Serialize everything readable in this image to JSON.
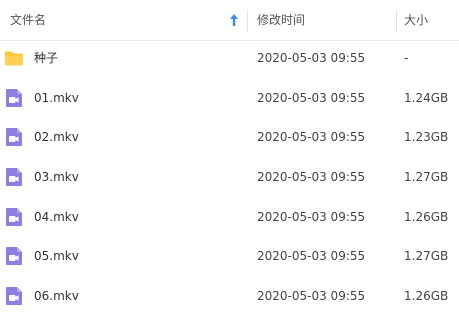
{
  "header": {
    "name_label": "文件名",
    "modified_label": "修改时间",
    "size_label": "大小",
    "sort_icon": "sort-ascending-arrow-icon"
  },
  "colors": {
    "folder": "#ffc53d",
    "video": "#8b7fe0",
    "sort_arrow": "#3b8ded"
  },
  "files": [
    {
      "name": "种子",
      "modified": "2020-05-03 09:55",
      "size": "-",
      "icon": "folder-icon"
    },
    {
      "name": "01.mkv",
      "modified": "2020-05-03 09:55",
      "size": "1.24GB",
      "icon": "video-file-icon"
    },
    {
      "name": "02.mkv",
      "modified": "2020-05-03 09:55",
      "size": "1.23GB",
      "icon": "video-file-icon"
    },
    {
      "name": "03.mkv",
      "modified": "2020-05-03 09:55",
      "size": "1.27GB",
      "icon": "video-file-icon"
    },
    {
      "name": "04.mkv",
      "modified": "2020-05-03 09:55",
      "size": "1.26GB",
      "icon": "video-file-icon"
    },
    {
      "name": "05.mkv",
      "modified": "2020-05-03 09:55",
      "size": "1.27GB",
      "icon": "video-file-icon"
    },
    {
      "name": "06.mkv",
      "modified": "2020-05-03 09:55",
      "size": "1.26GB",
      "icon": "video-file-icon"
    }
  ]
}
